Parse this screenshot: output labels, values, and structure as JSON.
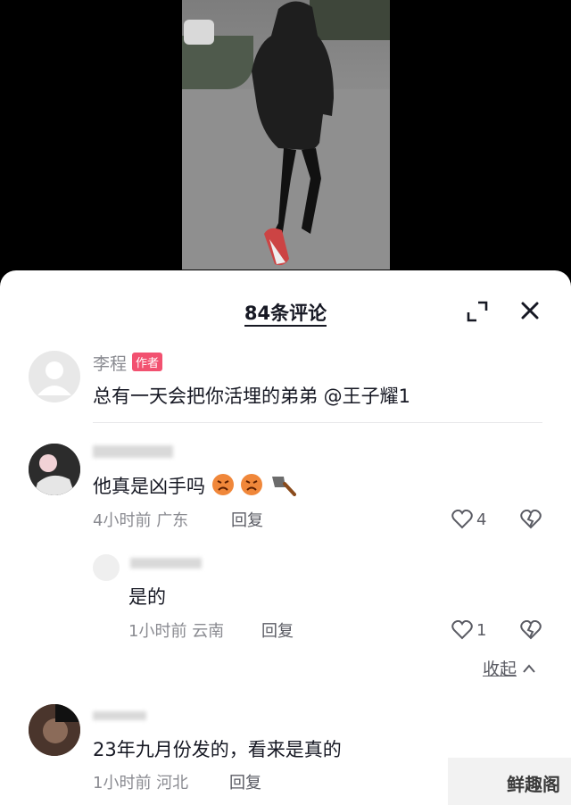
{
  "header": {
    "title": "84条评论"
  },
  "comments": [
    {
      "name": "李程",
      "badge": "作者",
      "text": "总有一天会把你活埋的弟弟 @王子耀1"
    },
    {
      "text": "他真是凶手吗",
      "time": "4小时前",
      "location": "广东",
      "reply_label": "回复",
      "likes": "4",
      "reply": {
        "text": "是的",
        "time": "1小时前",
        "location": "云南",
        "reply_label": "回复",
        "likes": "1"
      }
    },
    {
      "text": "23年九月份发的，看来是真的",
      "time": "1小时前",
      "location": "河北",
      "reply_label": "回复"
    }
  ],
  "collapse_label": "收起",
  "watermark": "鲜趣阁",
  "colors": {
    "badge": "#f25170",
    "text": "#161823",
    "meta": "#8a8b91"
  }
}
